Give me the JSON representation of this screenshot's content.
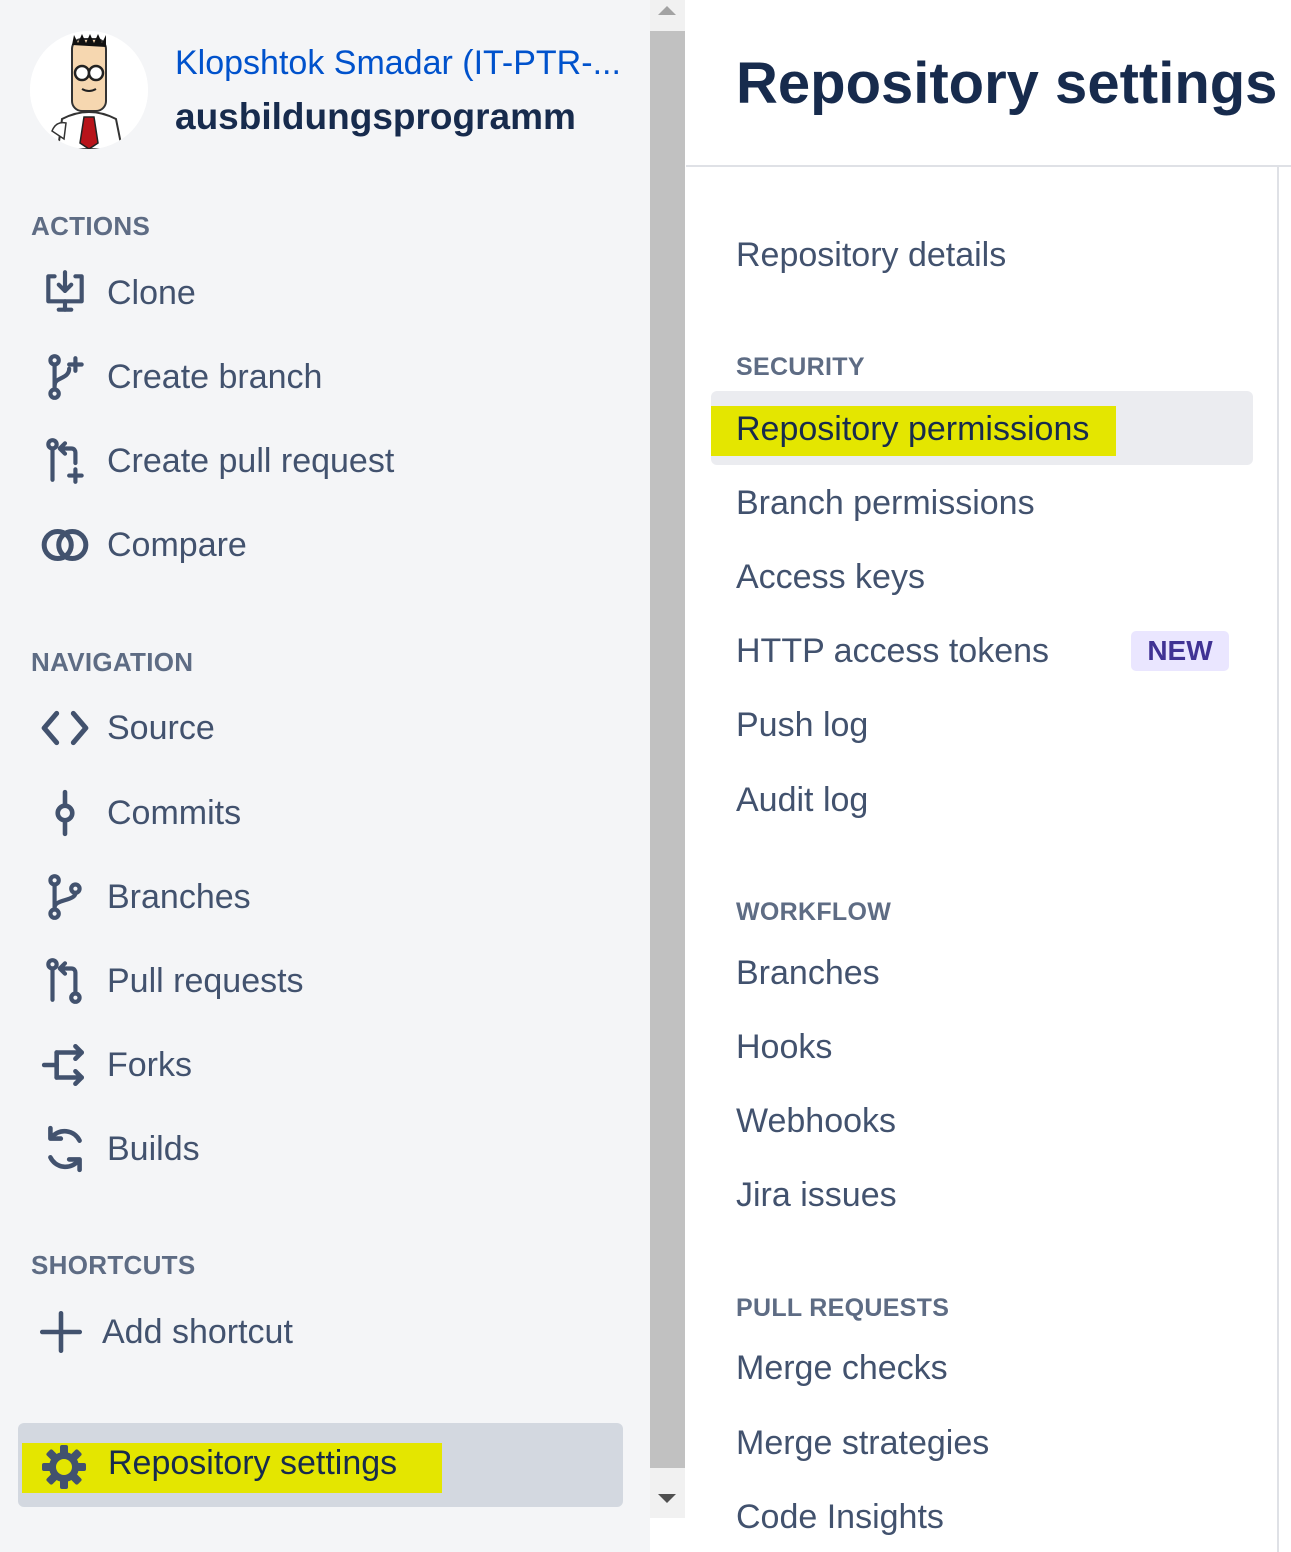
{
  "sidebar": {
    "project_name": "Klopshtok Smadar (IT-PTR-...",
    "repo_name": "ausbildungsprogramm",
    "actions": {
      "title": "ACTIONS",
      "items": [
        {
          "label": "Clone",
          "icon": "clone-icon"
        },
        {
          "label": "Create branch",
          "icon": "create-branch-icon"
        },
        {
          "label": "Create pull request",
          "icon": "create-pull-request-icon"
        },
        {
          "label": "Compare",
          "icon": "compare-icon"
        }
      ]
    },
    "navigation": {
      "title": "NAVIGATION",
      "items": [
        {
          "label": "Source",
          "icon": "source-icon"
        },
        {
          "label": "Commits",
          "icon": "commits-icon"
        },
        {
          "label": "Branches",
          "icon": "branches-icon"
        },
        {
          "label": "Pull requests",
          "icon": "pull-requests-icon"
        },
        {
          "label": "Forks",
          "icon": "forks-icon"
        },
        {
          "label": "Builds",
          "icon": "builds-icon"
        }
      ]
    },
    "shortcuts": {
      "title": "SHORTCUTS",
      "add_label": "Add shortcut"
    },
    "settings_label": "Repository settings"
  },
  "main": {
    "title": "Repository settings",
    "repository_details": "Repository details",
    "security": {
      "title": "SECURITY",
      "items": [
        "Repository permissions",
        "Branch permissions",
        "Access keys",
        "HTTP access tokens",
        "Push log",
        "Audit log"
      ],
      "new_badge": "NEW"
    },
    "workflow": {
      "title": "WORKFLOW",
      "items": [
        "Branches",
        "Hooks",
        "Webhooks",
        "Jira issues"
      ]
    },
    "pull_requests": {
      "title": "PULL REQUESTS",
      "items": [
        "Merge checks",
        "Merge strategies",
        "Code Insights"
      ]
    }
  },
  "colors": {
    "link": "#0052cc",
    "heading": "#172b4d",
    "text": "#42526e",
    "highlight": "#e4e600",
    "badge_bg": "#eae6ff",
    "badge_text": "#403294"
  }
}
